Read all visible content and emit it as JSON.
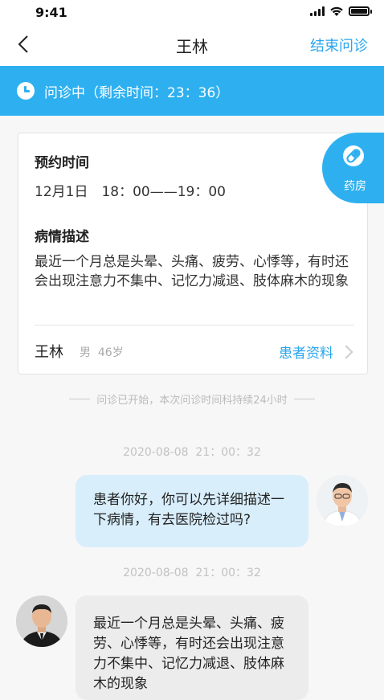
{
  "status_bar": {
    "time": "9:41"
  },
  "nav": {
    "title": "王林",
    "end_label": "结束问诊"
  },
  "banner": {
    "text": "问诊中（剩余时间：23：36）"
  },
  "appointment": {
    "time_label": "预约时间",
    "time_value": "12月1日　18：00——19：00",
    "condition_label": "病情描述",
    "condition_text": "最近一个月总是头晕、头痛、疲劳、心悸等，有时还会出现注意力不集中、记忆力减退、肢体麻木的现象",
    "patient_name": "王林",
    "patient_meta": "男  46岁",
    "patient_link": "患者资料"
  },
  "pharmacy": {
    "label": "药房"
  },
  "notice": "问诊已开始，本次问诊时间科持续24小时",
  "messages": [
    {
      "timestamp": "2020-08-08  21：00：32",
      "text": "患者你好，你可以先详细描述一下病情，有去医院检过吗?"
    },
    {
      "timestamp": "2020-08-08  21：00：32",
      "text": "最近一个月总是头晕、头痛、疲劳、心悸等，有时还会出现注意力不集中、记忆力减退、肢体麻木的现象"
    }
  ],
  "colors": {
    "accent": "#2eb0f0",
    "link": "#2aa6ee",
    "doctor_bubble": "#d8eefb",
    "patient_bubble": "#ececec"
  }
}
